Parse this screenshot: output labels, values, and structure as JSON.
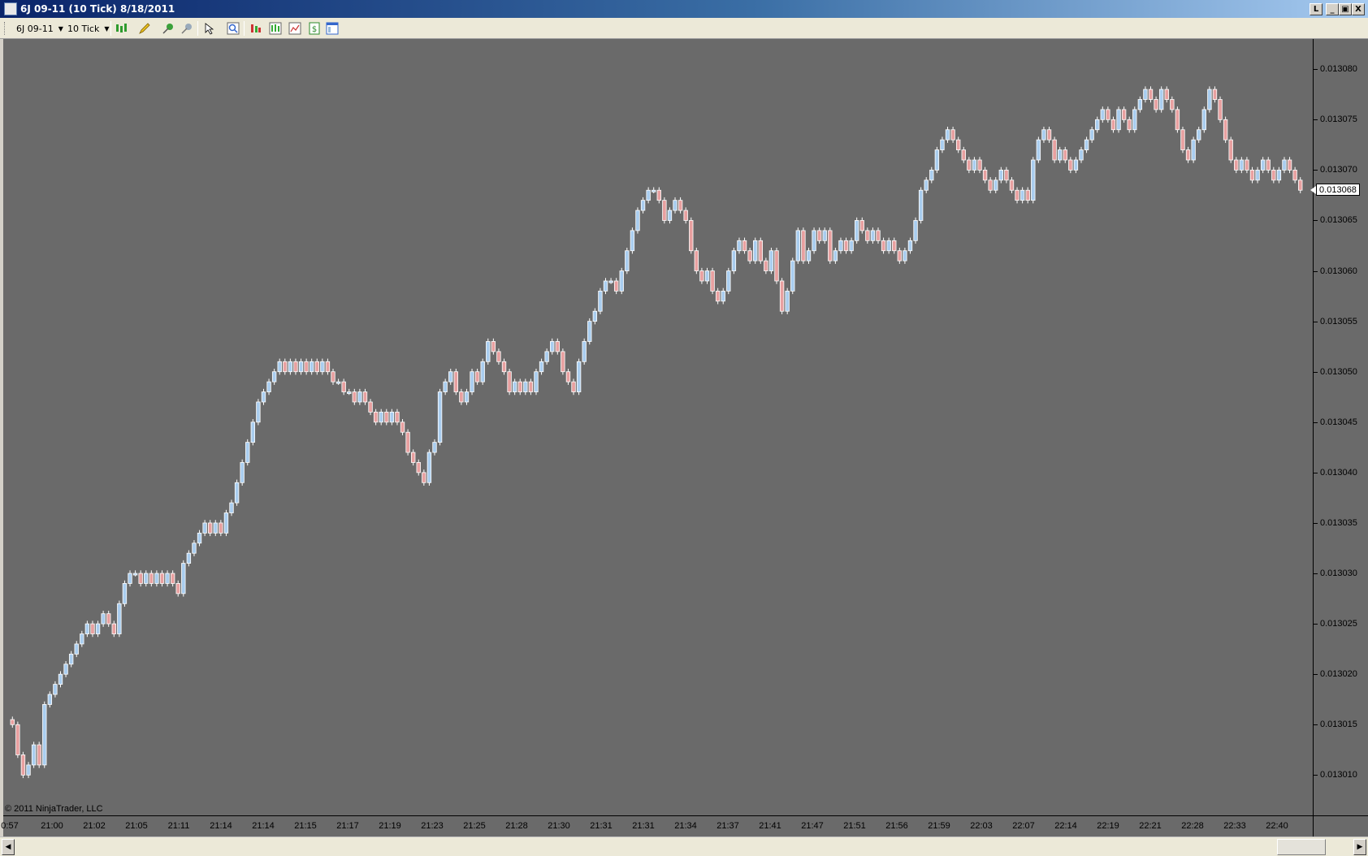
{
  "window": {
    "title": "6J 09-11 (10 Tick)  8/18/2011",
    "buttons": {
      "restore_left": "L",
      "minimize": "_",
      "maximize": "▣",
      "close": "X"
    }
  },
  "toolbar": {
    "instrument": "6J 09-11",
    "interval": "10 Tick",
    "icons": [
      "chart-style-icon",
      "drawing-pencil-icon",
      "pin-icon",
      "zoom-pin-icon",
      "pointer-icon",
      "magnifier-icon",
      "bar-spacing-icon",
      "indicators-icon",
      "strategy-icon",
      "dollar-icon",
      "properties-icon"
    ]
  },
  "colors": {
    "background": "#6a6a6a",
    "up_bar": "#a9cdef",
    "down_bar": "#e8a0a0",
    "bar_outline": "#ffffff"
  },
  "chart_data": {
    "type": "candlestick",
    "price_axis": {
      "labels": [
        "0.013080",
        "0.013075",
        "0.013070",
        "0.013065",
        "0.013060",
        "0.013055",
        "0.013050",
        "0.013045",
        "0.013040",
        "0.013035",
        "0.013030",
        "0.013025",
        "0.013020",
        "0.013015",
        "0.013010"
      ],
      "range": [
        0.013006,
        0.013083
      ]
    },
    "time_axis": {
      "labels": [
        "0:57",
        "21:00",
        "21:02",
        "21:05",
        "21:11",
        "21:14",
        "21:14",
        "21:15",
        "21:17",
        "21:19",
        "21:23",
        "21:25",
        "21:28",
        "21:30",
        "21:31",
        "21:31",
        "21:34",
        "21:37",
        "21:41",
        "21:47",
        "21:51",
        "21:56",
        "21:59",
        "22:03",
        "22:07",
        "22:14",
        "22:19",
        "22:21",
        "22:28",
        "22:33",
        "22:40"
      ]
    },
    "last_price": "0.013068",
    "closes": [
      0.013015,
      0.013012,
      0.01301,
      0.013011,
      0.013013,
      0.013011,
      0.013017,
      0.013018,
      0.013019,
      0.01302,
      0.013021,
      0.013022,
      0.013023,
      0.013024,
      0.013025,
      0.013024,
      0.013025,
      0.013026,
      0.013025,
      0.013024,
      0.013027,
      0.013029,
      0.01303,
      0.01303,
      0.013029,
      0.01303,
      0.013029,
      0.01303,
      0.013029,
      0.01303,
      0.013029,
      0.013028,
      0.013031,
      0.013032,
      0.013033,
      0.013034,
      0.013035,
      0.013034,
      0.013035,
      0.013034,
      0.013036,
      0.013037,
      0.013039,
      0.013041,
      0.013043,
      0.013045,
      0.013047,
      0.013048,
      0.013049,
      0.01305,
      0.013051,
      0.01305,
      0.013051,
      0.01305,
      0.013051,
      0.01305,
      0.013051,
      0.01305,
      0.013051,
      0.01305,
      0.013049,
      0.013049,
      0.013048,
      0.013048,
      0.013047,
      0.013048,
      0.013047,
      0.013046,
      0.013045,
      0.013046,
      0.013045,
      0.013046,
      0.013045,
      0.013044,
      0.013042,
      0.013041,
      0.01304,
      0.013039,
      0.013042,
      0.013043,
      0.013048,
      0.013049,
      0.01305,
      0.013048,
      0.013047,
      0.013048,
      0.01305,
      0.013049,
      0.013051,
      0.013053,
      0.013052,
      0.013051,
      0.01305,
      0.013048,
      0.013049,
      0.013048,
      0.013049,
      0.013048,
      0.01305,
      0.013051,
      0.013052,
      0.013053,
      0.013052,
      0.01305,
      0.013049,
      0.013048,
      0.013051,
      0.013053,
      0.013055,
      0.013056,
      0.013058,
      0.013059,
      0.013059,
      0.013058,
      0.01306,
      0.013062,
      0.013064,
      0.013066,
      0.013067,
      0.013068,
      0.013068,
      0.013067,
      0.013065,
      0.013066,
      0.013067,
      0.013066,
      0.013065,
      0.013062,
      0.01306,
      0.013059,
      0.01306,
      0.013058,
      0.013057,
      0.013058,
      0.01306,
      0.013062,
      0.013063,
      0.013062,
      0.013061,
      0.013063,
      0.013061,
      0.01306,
      0.013062,
      0.013059,
      0.013056,
      0.013058,
      0.013061,
      0.013064,
      0.013061,
      0.013062,
      0.013064,
      0.013063,
      0.013064,
      0.013061,
      0.013062,
      0.013063,
      0.013062,
      0.013063,
      0.013065,
      0.013064,
      0.013063,
      0.013064,
      0.013063,
      0.013062,
      0.013063,
      0.013062,
      0.013061,
      0.013062,
      0.013063,
      0.013065,
      0.013068,
      0.013069,
      0.01307,
      0.013072,
      0.013073,
      0.013074,
      0.013073,
      0.013072,
      0.013071,
      0.01307,
      0.013071,
      0.01307,
      0.013069,
      0.013068,
      0.013069,
      0.01307,
      0.013069,
      0.013068,
      0.013067,
      0.013068,
      0.013067,
      0.013071,
      0.013073,
      0.013074,
      0.013073,
      0.013071,
      0.013072,
      0.013071,
      0.01307,
      0.013071,
      0.013072,
      0.013073,
      0.013074,
      0.013075,
      0.013076,
      0.013075,
      0.013074,
      0.013076,
      0.013075,
      0.013074,
      0.013076,
      0.013077,
      0.013078,
      0.013077,
      0.013076,
      0.013078,
      0.013077,
      0.013076,
      0.013074,
      0.013072,
      0.013071,
      0.013073,
      0.013074,
      0.013076,
      0.013078,
      0.013077,
      0.013075,
      0.013073,
      0.013071,
      0.01307,
      0.013071,
      0.01307,
      0.013069,
      0.01307,
      0.013071,
      0.01307,
      0.013069,
      0.01307,
      0.013071,
      0.01307,
      0.013069,
      0.013068
    ]
  },
  "footer": {
    "copyright": "© 2011 NinjaTrader, LLC"
  },
  "scrollbar": {
    "left_arrow": "◀",
    "right_arrow": "▶",
    "position": 0.98
  }
}
